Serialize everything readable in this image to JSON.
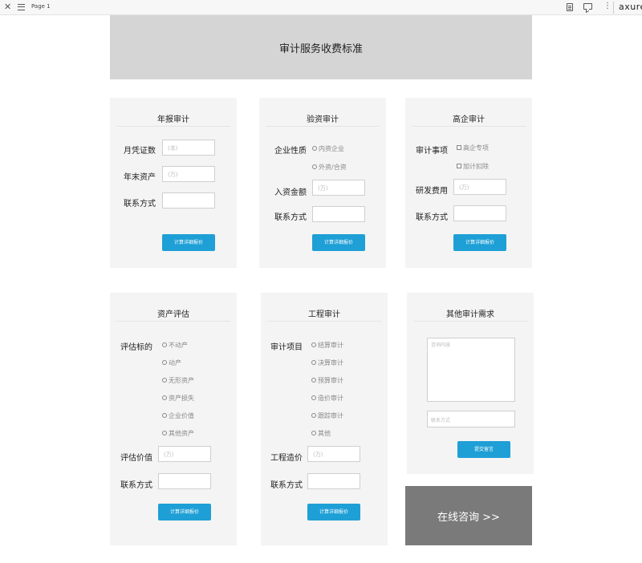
{
  "topbar": {
    "page_name": "Page 1",
    "brand": "axure",
    "icons": [
      "close-icon",
      "menu-icon",
      "document-icon",
      "comment-icon",
      "more-icon"
    ]
  },
  "banner": {
    "title": "审计服务收费标准"
  },
  "annual": {
    "title": "年报审计",
    "vouchers_label": "月凭证数",
    "vouchers_placeholder": "(本)",
    "assets_label": "年末资产",
    "assets_placeholder": "(万)",
    "contact_label": "联系方式",
    "button": "计算详细报价"
  },
  "capital": {
    "title": "验资审计",
    "nature_label": "企业性质",
    "options": [
      "内资企业",
      "外资/合资"
    ],
    "amount_label": "入资金额",
    "amount_placeholder": "(万)",
    "contact_label": "联系方式",
    "button": "计算详细报价"
  },
  "hightech": {
    "title": "高企审计",
    "matter_label": "审计事项",
    "options": [
      "高企专项",
      "加计扣除"
    ],
    "rd_label": "研发费用",
    "rd_placeholder": "(万)",
    "contact_label": "联系方式",
    "button": "计算详细报价"
  },
  "appraisal": {
    "title": "资产评估",
    "target_label": "评估标的",
    "options": [
      "不动产",
      "动产",
      "无形资产",
      "资产损失",
      "企业价值",
      "其他资产"
    ],
    "value_label": "评估价值",
    "value_placeholder": "(万)",
    "contact_label": "联系方式",
    "button": "计算详细报价"
  },
  "engineering": {
    "title": "工程审计",
    "item_label": "审计项目",
    "options": [
      "结算审计",
      "决算审计",
      "预算审计",
      "造价审计",
      "跟踪审计",
      "其他"
    ],
    "cost_label": "工程造价",
    "cost_placeholder": "(万)",
    "contact_label": "联系方式",
    "button": "计算详细报价"
  },
  "other": {
    "title": "其他审计需求",
    "content_placeholder": "咨询内容",
    "contact_placeholder": "联系方式",
    "button": "提交留言"
  },
  "consult": {
    "label": "在线咨询 >>"
  },
  "colors": {
    "button": "#1e9fd6",
    "banner": "#d5d5d5",
    "card": "#f4f4f4",
    "consult": "#7a7a7a"
  }
}
